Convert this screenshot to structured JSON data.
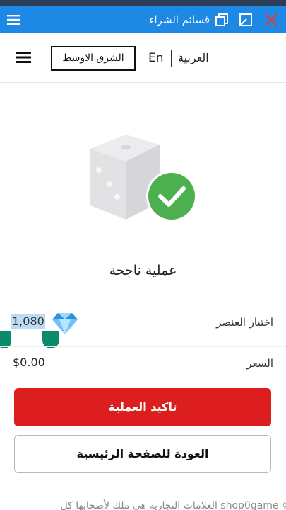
{
  "window": {
    "title": "قسائم الشراء",
    "icons": [
      "close-icon",
      "restore-icon",
      "copy-icon",
      "menu-icon"
    ]
  },
  "header": {
    "region_label": "الشرق الاوسط",
    "lang_en": "En",
    "lang_ar": "العربية"
  },
  "status": {
    "title": "عملية ناجحة"
  },
  "item": {
    "label": "اختيار العنصر",
    "value": "1,080",
    "icon": "diamond-icon"
  },
  "price": {
    "label": "السعر",
    "value": "$0.00"
  },
  "actions": {
    "confirm_label": "تاكيد العملية",
    "home_label": "العودة للصفحة الرئيسية"
  },
  "footer": {
    "text": "© shop0game العلامات التجارية هي ملك لأصحابها كل"
  },
  "colors": {
    "window_bar": "#1e88e5",
    "close_x": "#e53935",
    "confirm": "#dd1e1e",
    "success": "#4caf50",
    "selection_handle": "#0c8a6c",
    "selection_highlight": "#bcdcf5"
  }
}
